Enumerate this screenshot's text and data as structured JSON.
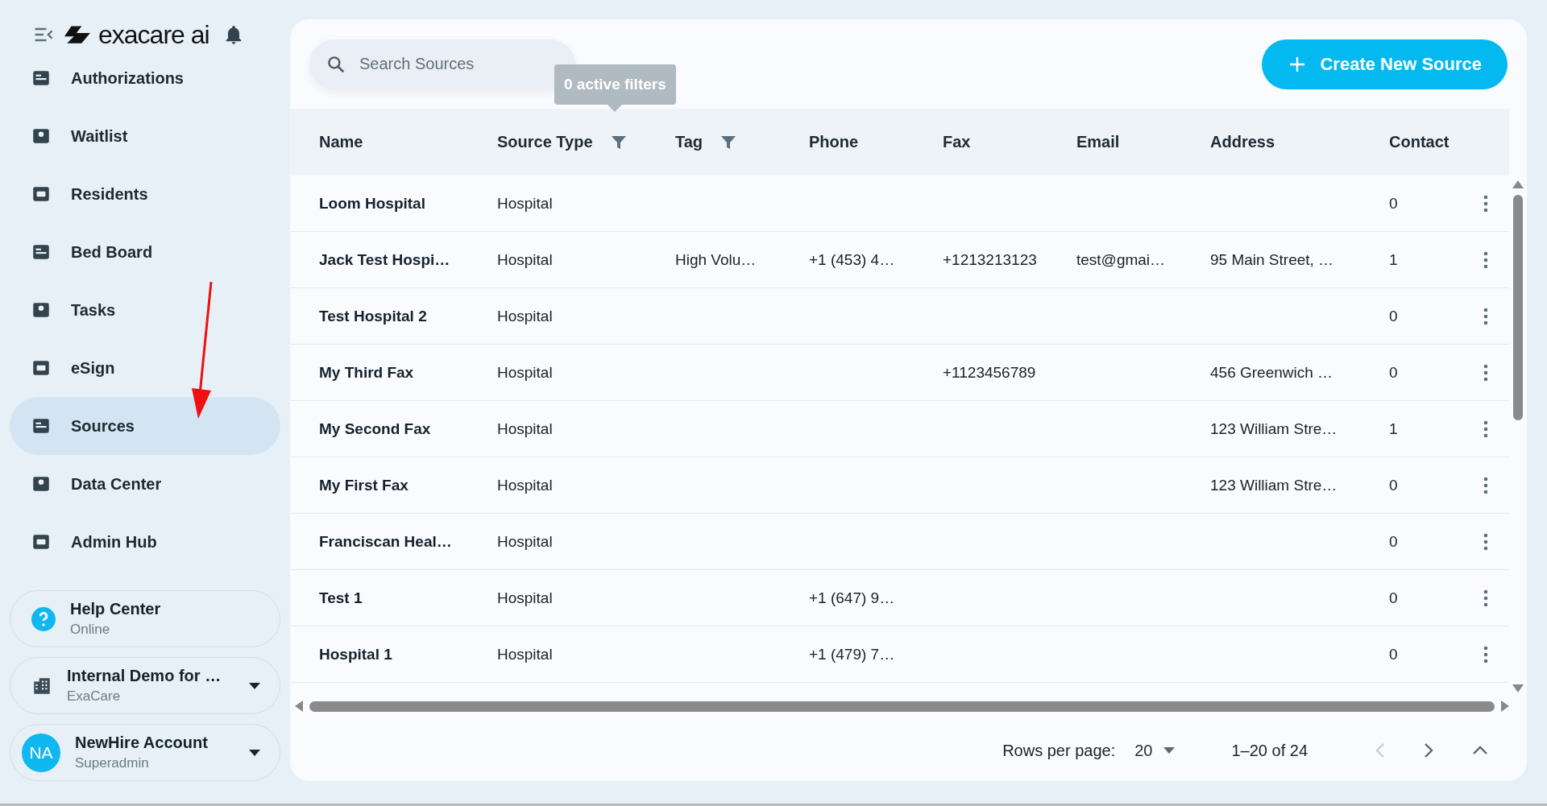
{
  "sidebar": {
    "logo": "exacare ai",
    "nav_items": [
      {
        "label": "Authorizations",
        "selected": false
      },
      {
        "label": "Waitlist",
        "selected": false
      },
      {
        "label": "Residents",
        "selected": false
      },
      {
        "label": "Bed Board",
        "selected": false
      },
      {
        "label": "Tasks",
        "selected": false
      },
      {
        "label": "eSign",
        "selected": false
      },
      {
        "label": "Sources",
        "selected": true
      },
      {
        "label": "Data Center",
        "selected": false
      },
      {
        "label": "Admin Hub",
        "selected": false
      }
    ],
    "help": {
      "title": "Help Center",
      "status": "Online"
    },
    "organization": {
      "name": "Internal Demo for …",
      "company": "ExaCare"
    },
    "account": {
      "initials": "NA",
      "name": "NewHire Account",
      "role": "Superadmin"
    }
  },
  "toolbar": {
    "search": {
      "placeholder": "Search Sources"
    },
    "tooltip": "0 active filters",
    "create_button": "Create New Source"
  },
  "table": {
    "columns": [
      {
        "label": "Name",
        "filter": false
      },
      {
        "label": "Source Type",
        "filter": true
      },
      {
        "label": "Tag",
        "filter": true
      },
      {
        "label": "Phone",
        "filter": false
      },
      {
        "label": "Fax",
        "filter": false
      },
      {
        "label": "Email",
        "filter": false
      },
      {
        "label": "Address",
        "filter": false
      },
      {
        "label": "Contact",
        "filter": false
      }
    ],
    "rows": [
      {
        "name": "Loom Hospital",
        "source_type": "Hospital",
        "tag": "",
        "phone": "",
        "fax": "",
        "email": "",
        "address": "",
        "contacts": "0"
      },
      {
        "name": "Jack Test Hospi…",
        "source_type": "Hospital",
        "tag": "High Volu…",
        "phone": "+1 (453) 4…",
        "fax": "+1213213123",
        "email": "test@gmai…",
        "address": "95 Main Street, …",
        "contacts": "1"
      },
      {
        "name": "Test Hospital 2",
        "source_type": "Hospital",
        "tag": "",
        "phone": "",
        "fax": "",
        "email": "",
        "address": "",
        "contacts": "0"
      },
      {
        "name": "My Third Fax",
        "source_type": "Hospital",
        "tag": "",
        "phone": "",
        "fax": "+1123456789",
        "email": "",
        "address": "456 Greenwich …",
        "contacts": "0"
      },
      {
        "name": "My Second Fax",
        "source_type": "Hospital",
        "tag": "",
        "phone": "",
        "fax": "",
        "email": "",
        "address": "123 William Stre…",
        "contacts": "1"
      },
      {
        "name": "My First Fax",
        "source_type": "Hospital",
        "tag": "",
        "phone": "",
        "fax": "",
        "email": "",
        "address": "123 William Stre…",
        "contacts": "0"
      },
      {
        "name": "Franciscan Heal…",
        "source_type": "Hospital",
        "tag": "",
        "phone": "",
        "fax": "",
        "email": "",
        "address": "",
        "contacts": "0"
      },
      {
        "name": "Test 1",
        "source_type": "Hospital",
        "tag": "",
        "phone": "+1 (647) 9…",
        "fax": "",
        "email": "",
        "address": "",
        "contacts": "0"
      },
      {
        "name": "Hospital 1",
        "source_type": "Hospital",
        "tag": "",
        "phone": "+1 (479) 7…",
        "fax": "",
        "email": "",
        "address": "",
        "contacts": "0"
      }
    ]
  },
  "pagination": {
    "rows_per_page_label": "Rows per page:",
    "rows_per_page": "20",
    "range": "1–20 of 24",
    "previous_disabled": true,
    "next_disabled": false
  }
}
